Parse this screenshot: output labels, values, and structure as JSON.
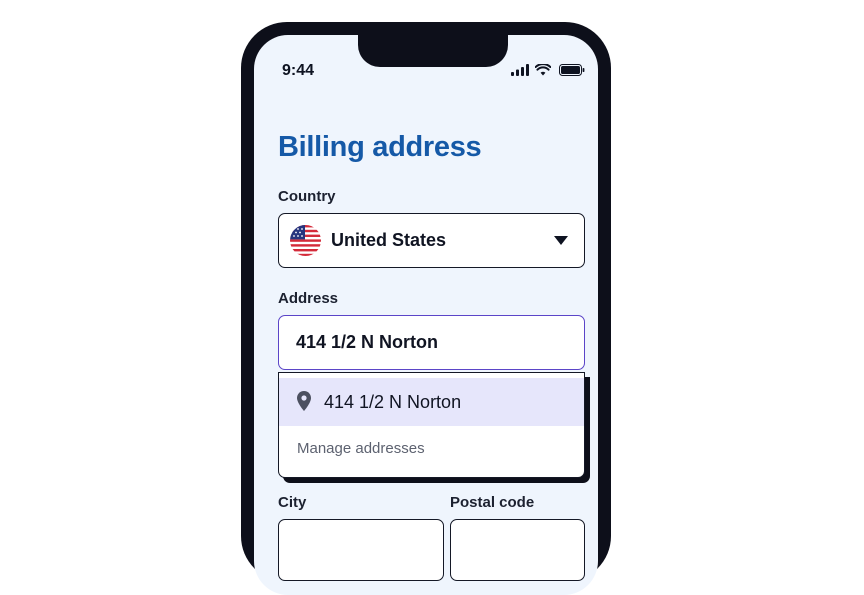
{
  "status_bar": {
    "time": "9:44"
  },
  "page": {
    "title": "Billing address"
  },
  "country": {
    "label": "Country",
    "value": "United States",
    "flag_icon": "us-flag-icon"
  },
  "address": {
    "label": "Address",
    "value": "414 1/2 N Norton"
  },
  "suggestions": {
    "items": [
      {
        "text": "414 1/2 N Norton",
        "icon": "location-pin-icon"
      }
    ],
    "manage_label": "Manage addresses"
  },
  "city": {
    "label": "City",
    "value": ""
  },
  "postal_code": {
    "label": "Postal code",
    "value": ""
  },
  "colors": {
    "title": "#1559a7",
    "screen_background": "#eff5fd",
    "focus_border": "#5b45c8",
    "highlight": "#e6e6fb"
  }
}
